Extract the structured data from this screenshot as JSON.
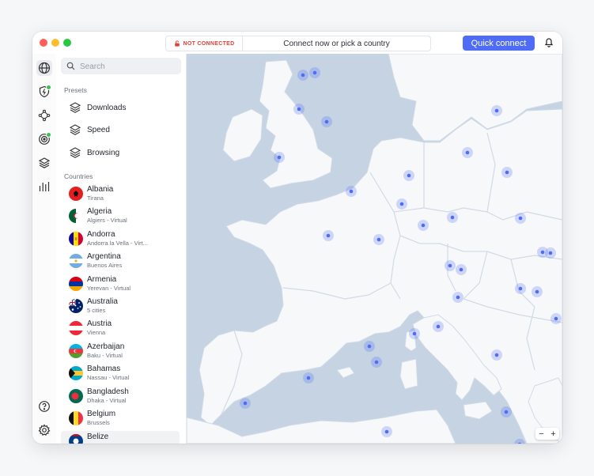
{
  "titlebar": {
    "status": "NOT CONNECTED",
    "message": "Connect now or pick a country",
    "quick_connect": "Quick connect"
  },
  "sidebar_icons": [
    "globe-icon",
    "shield-bolt-icon",
    "meshnet-icon",
    "target-icon",
    "layers-icon",
    "stats-icon",
    "help-icon",
    "settings-icon"
  ],
  "search": {
    "placeholder": "Search"
  },
  "presets": {
    "label": "Presets",
    "items": [
      {
        "label": "Downloads",
        "icon": "layers-icon"
      },
      {
        "label": "Speed",
        "icon": "layers-icon"
      },
      {
        "label": "Browsing",
        "icon": "layers-icon"
      }
    ]
  },
  "countries": {
    "label": "Countries",
    "items": [
      {
        "name": "Albania",
        "sub": "Tirana"
      },
      {
        "name": "Algeria",
        "sub": "Algiers - Virtual"
      },
      {
        "name": "Andorra",
        "sub": "Andorra la Vella - Virt..."
      },
      {
        "name": "Argentina",
        "sub": "Buenos Aires"
      },
      {
        "name": "Armenia",
        "sub": "Yerevan - Virtual"
      },
      {
        "name": "Australia",
        "sub": "5 cities"
      },
      {
        "name": "Austria",
        "sub": "Vienna"
      },
      {
        "name": "Azerbaijan",
        "sub": "Baku - Virtual"
      },
      {
        "name": "Bahamas",
        "sub": "Nassau - Virtual"
      },
      {
        "name": "Bangladesh",
        "sub": "Dhaka - Virtual"
      },
      {
        "name": "Belgium",
        "sub": "Brussels"
      },
      {
        "name": "Belize",
        "sub": ""
      }
    ]
  },
  "zoom": {
    "minus": "−",
    "plus": "+"
  },
  "colors": {
    "accent": "#4f6cf7",
    "status_red": "#e0403a",
    "sea": "#c5d3e3",
    "land": "#f7f8fa",
    "server_dot": "#4f6cf7"
  }
}
